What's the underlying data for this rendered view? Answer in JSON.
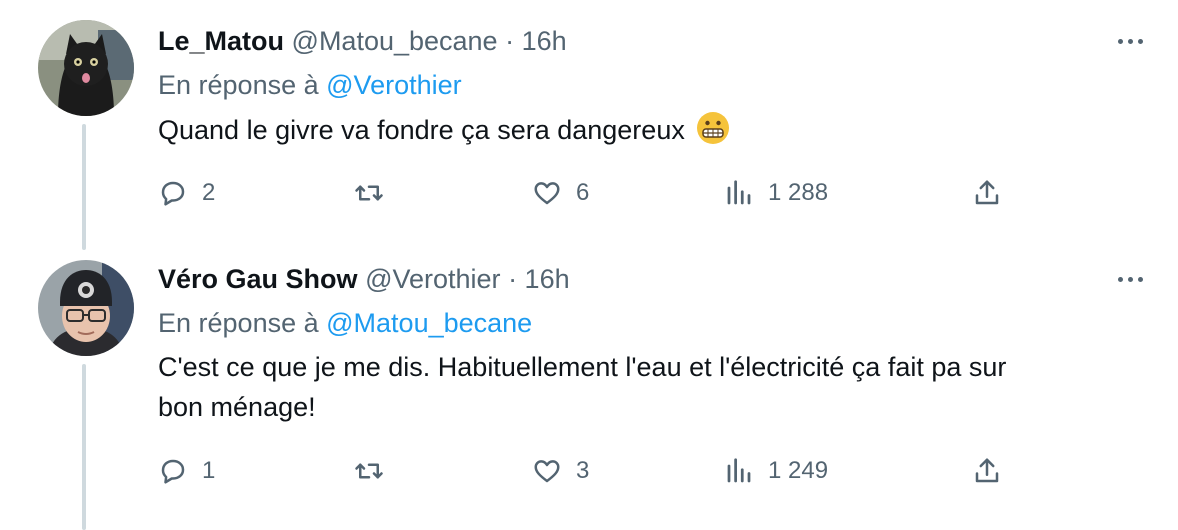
{
  "tweets": [
    {
      "name": "Le_Matou",
      "handle": "@Matou_becane",
      "time": "· 16h",
      "reply_prefix": "En réponse à",
      "reply_to": "@Verothier",
      "text": "Quand le givre va fondre ça sera dangereux",
      "emoji": "grimacing-face-emoji",
      "stats": {
        "replies": "2",
        "retweets": "",
        "likes": "6",
        "views": "1 288"
      }
    },
    {
      "name": "Véro Gau Show",
      "handle": "@Verothier",
      "time": "· 16h",
      "reply_prefix": "En réponse à",
      "reply_to": "@Matou_becane",
      "text_line1": "C'est ce que je me dis. Habituellement l'eau et l'électricité ça fait pa sur",
      "text_line2": "bon ménage!",
      "stats": {
        "replies": "1",
        "retweets": "",
        "likes": "3",
        "views": "1 249"
      }
    }
  ],
  "colors": {
    "text": "#0f1419",
    "secondary": "#536471",
    "accent": "#1d9bf0",
    "thread": "#cfd9de"
  },
  "icons": [
    "reply-icon",
    "retweet-icon",
    "like-icon",
    "views-icon",
    "share-icon",
    "more-icon"
  ]
}
